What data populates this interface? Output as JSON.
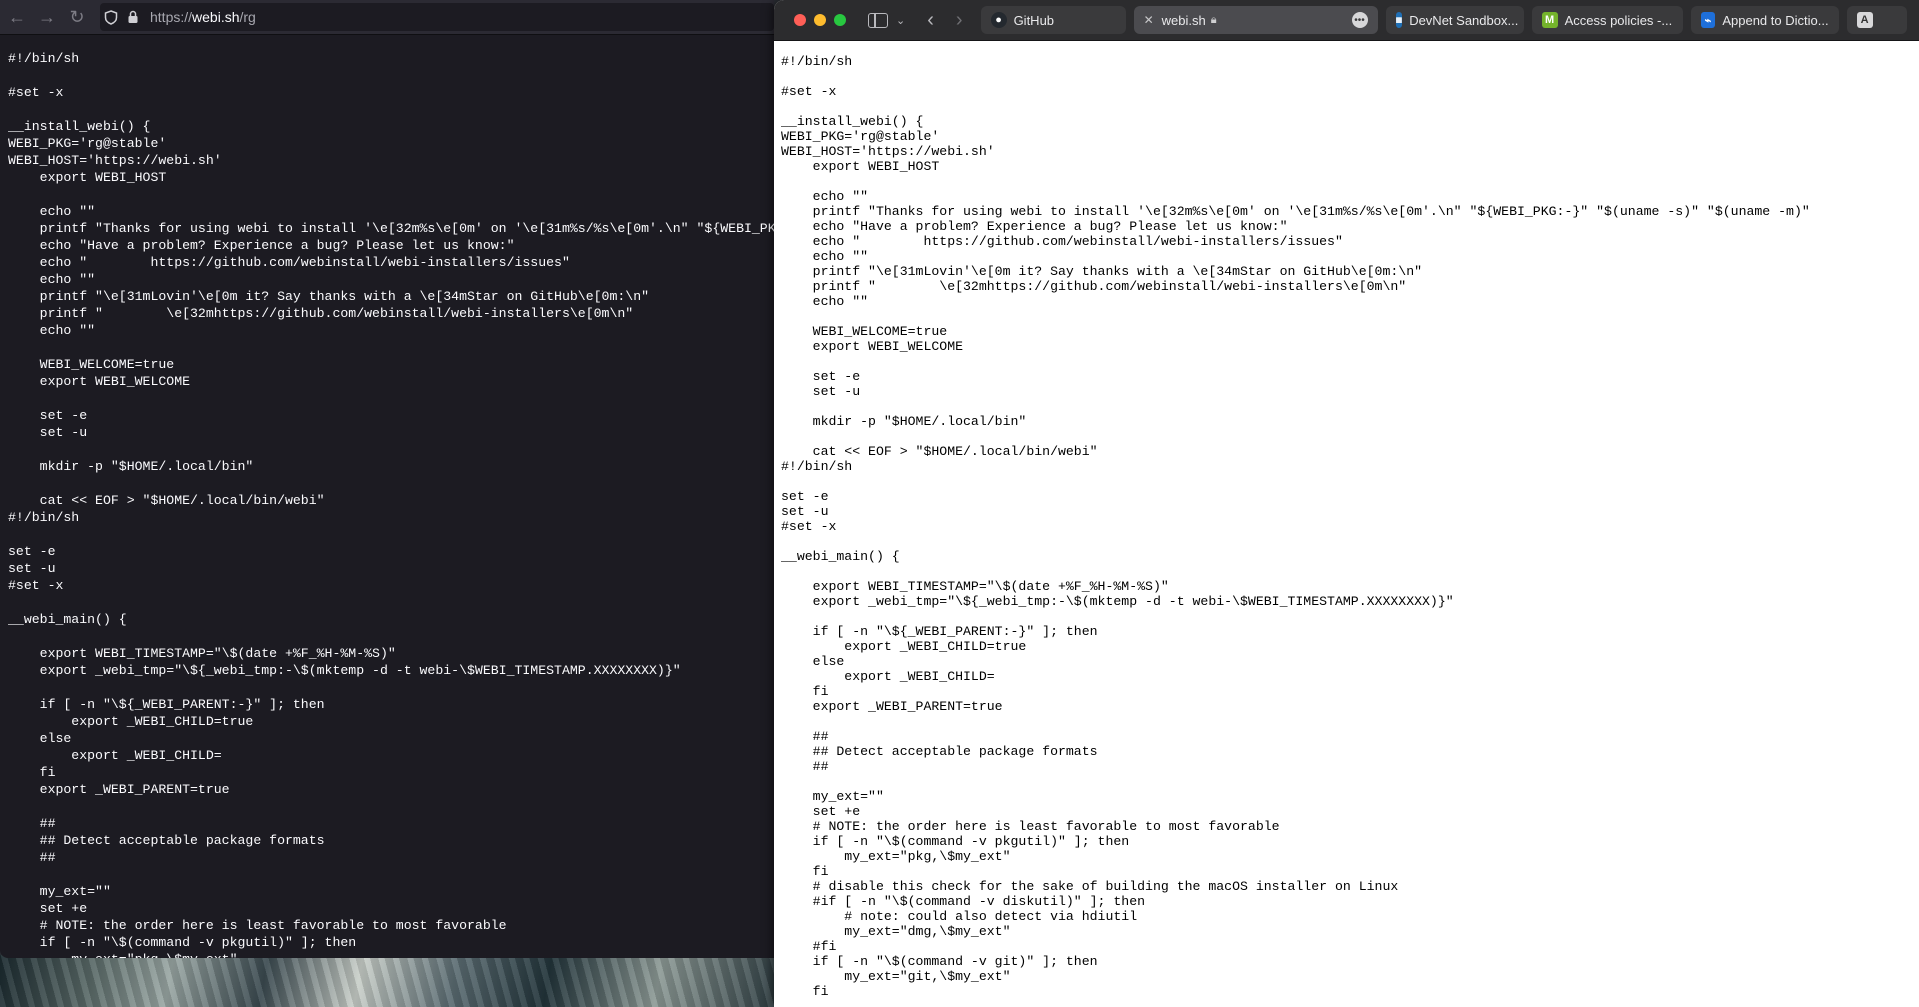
{
  "left_browser": {
    "url_prefix": "https://",
    "url_host": "webi.sh",
    "url_path": "/rg",
    "content": "#!/bin/sh\n\n#set -x\n\n__install_webi() {\nWEBI_PKG='rg@stable'\nWEBI_HOST='https://webi.sh'\n    export WEBI_HOST\n\n    echo \"\"\n    printf \"Thanks for using webi to install '\\e[32m%s\\e[0m' on '\\e[31m%s/%s\\e[0m'.\\n\" \"${WEBI_PKG:-}\" \"$(uname -s)\" \"$(uname -m)\"\n    echo \"Have a problem? Experience a bug? Please let us know:\"\n    echo \"        https://github.com/webinstall/webi-installers/issues\"\n    echo \"\"\n    printf \"\\e[31mLovin'\\e[0m it? Say thanks with a \\e[34mStar on GitHub\\e[0m:\\n\"\n    printf \"        \\e[32mhttps://github.com/webinstall/webi-installers\\e[0m\\n\"\n    echo \"\"\n\n    WEBI_WELCOME=true\n    export WEBI_WELCOME\n\n    set -e\n    set -u\n\n    mkdir -p \"$HOME/.local/bin\"\n\n    cat << EOF > \"$HOME/.local/bin/webi\"\n#!/bin/sh\n\nset -e\nset -u\n#set -x\n\n__webi_main() {\n\n    export WEBI_TIMESTAMP=\"\\$(date +%F_%H-%M-%S)\"\n    export _webi_tmp=\"\\${_webi_tmp:-\\$(mktemp -d -t webi-\\$WEBI_TIMESTAMP.XXXXXXXX)}\"\n\n    if [ -n \"\\${_WEBI_PARENT:-}\" ]; then\n        export _WEBI_CHILD=true\n    else\n        export _WEBI_CHILD=\n    fi\n    export _WEBI_PARENT=true\n\n    ##\n    ## Detect acceptable package formats\n    ##\n\n    my_ext=\"\"\n    set +e\n    # NOTE: the order here is least favorable to most favorable\n    if [ -n \"\\$(command -v pkgutil)\" ]; then\n        my_ext=\"pkg,\\$my_ext\""
  },
  "safari": {
    "tabs": [
      {
        "label": "GitHub",
        "icon": "github-icon",
        "color": "#24292f"
      },
      {
        "label": "webi.sh",
        "icon": "webi-icon",
        "color": "#d13a3a",
        "active": true
      },
      {
        "label": "DevNet Sandbox...",
        "icon": "devnet-icon",
        "color": "#1f6fb5"
      },
      {
        "label": "Access policies -...",
        "icon": "m-icon",
        "color": "#74b32b"
      },
      {
        "label": "Append to Dictio...",
        "icon": "append-icon",
        "color": "#1e6fd9"
      }
    ],
    "partial_tab_letter": "A",
    "content": "#!/bin/sh\n\n#set -x\n\n__install_webi() {\nWEBI_PKG='rg@stable'\nWEBI_HOST='https://webi.sh'\n    export WEBI_HOST\n\n    echo \"\"\n    printf \"Thanks for using webi to install '\\e[32m%s\\e[0m' on '\\e[31m%s/%s\\e[0m'.\\n\" \"${WEBI_PKG:-}\" \"$(uname -s)\" \"$(uname -m)\"\n    echo \"Have a problem? Experience a bug? Please let us know:\"\n    echo \"        https://github.com/webinstall/webi-installers/issues\"\n    echo \"\"\n    printf \"\\e[31mLovin'\\e[0m it? Say thanks with a \\e[34mStar on GitHub\\e[0m:\\n\"\n    printf \"        \\e[32mhttps://github.com/webinstall/webi-installers\\e[0m\\n\"\n    echo \"\"\n\n    WEBI_WELCOME=true\n    export WEBI_WELCOME\n\n    set -e\n    set -u\n\n    mkdir -p \"$HOME/.local/bin\"\n\n    cat << EOF > \"$HOME/.local/bin/webi\"\n#!/bin/sh\n\nset -e\nset -u\n#set -x\n\n__webi_main() {\n\n    export WEBI_TIMESTAMP=\"\\$(date +%F_%H-%M-%S)\"\n    export _webi_tmp=\"\\${_webi_tmp:-\\$(mktemp -d -t webi-\\$WEBI_TIMESTAMP.XXXXXXXX)}\"\n\n    if [ -n \"\\${_WEBI_PARENT:-}\" ]; then\n        export _WEBI_CHILD=true\n    else\n        export _WEBI_CHILD=\n    fi\n    export _WEBI_PARENT=true\n\n    ##\n    ## Detect acceptable package formats\n    ##\n\n    my_ext=\"\"\n    set +e\n    # NOTE: the order here is least favorable to most favorable\n    if [ -n \"\\$(command -v pkgutil)\" ]; then\n        my_ext=\"pkg,\\$my_ext\"\n    fi\n    # disable this check for the sake of building the macOS installer on Linux\n    #if [ -n \"\\$(command -v diskutil)\" ]; then\n        # note: could also detect via hdiutil\n        my_ext=\"dmg,\\$my_ext\"\n    #fi\n    if [ -n \"\\$(command -v git)\" ]; then\n        my_ext=\"git,\\$my_ext\"\n    fi"
  }
}
